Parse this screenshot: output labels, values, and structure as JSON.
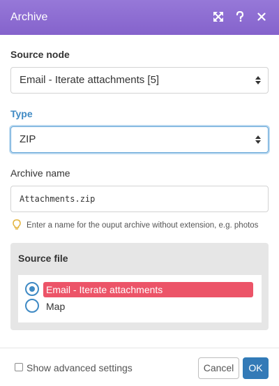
{
  "dialog": {
    "title": "Archive",
    "header_icons": [
      "expand-icon",
      "help-icon",
      "close-icon"
    ],
    "accent_color": "#8563cc"
  },
  "source_node": {
    "label": "Source node",
    "value": "Email - Iterate attachments [5]"
  },
  "type": {
    "label": "Type",
    "value": "ZIP"
  },
  "archive_name": {
    "label": "Archive name",
    "value": "Attachments.zip",
    "hint": "Enter a name for the ouput archive without extension, e.g. photos"
  },
  "source_file": {
    "title": "Source file",
    "options": [
      {
        "label": "Email - Iterate attachments",
        "selected": true
      },
      {
        "label": "Map",
        "selected": false
      }
    ],
    "selected_color": "#ec5468"
  },
  "footer": {
    "advanced_label": "Show advanced settings",
    "advanced_checked": false,
    "cancel_label": "Cancel",
    "ok_label": "OK"
  }
}
